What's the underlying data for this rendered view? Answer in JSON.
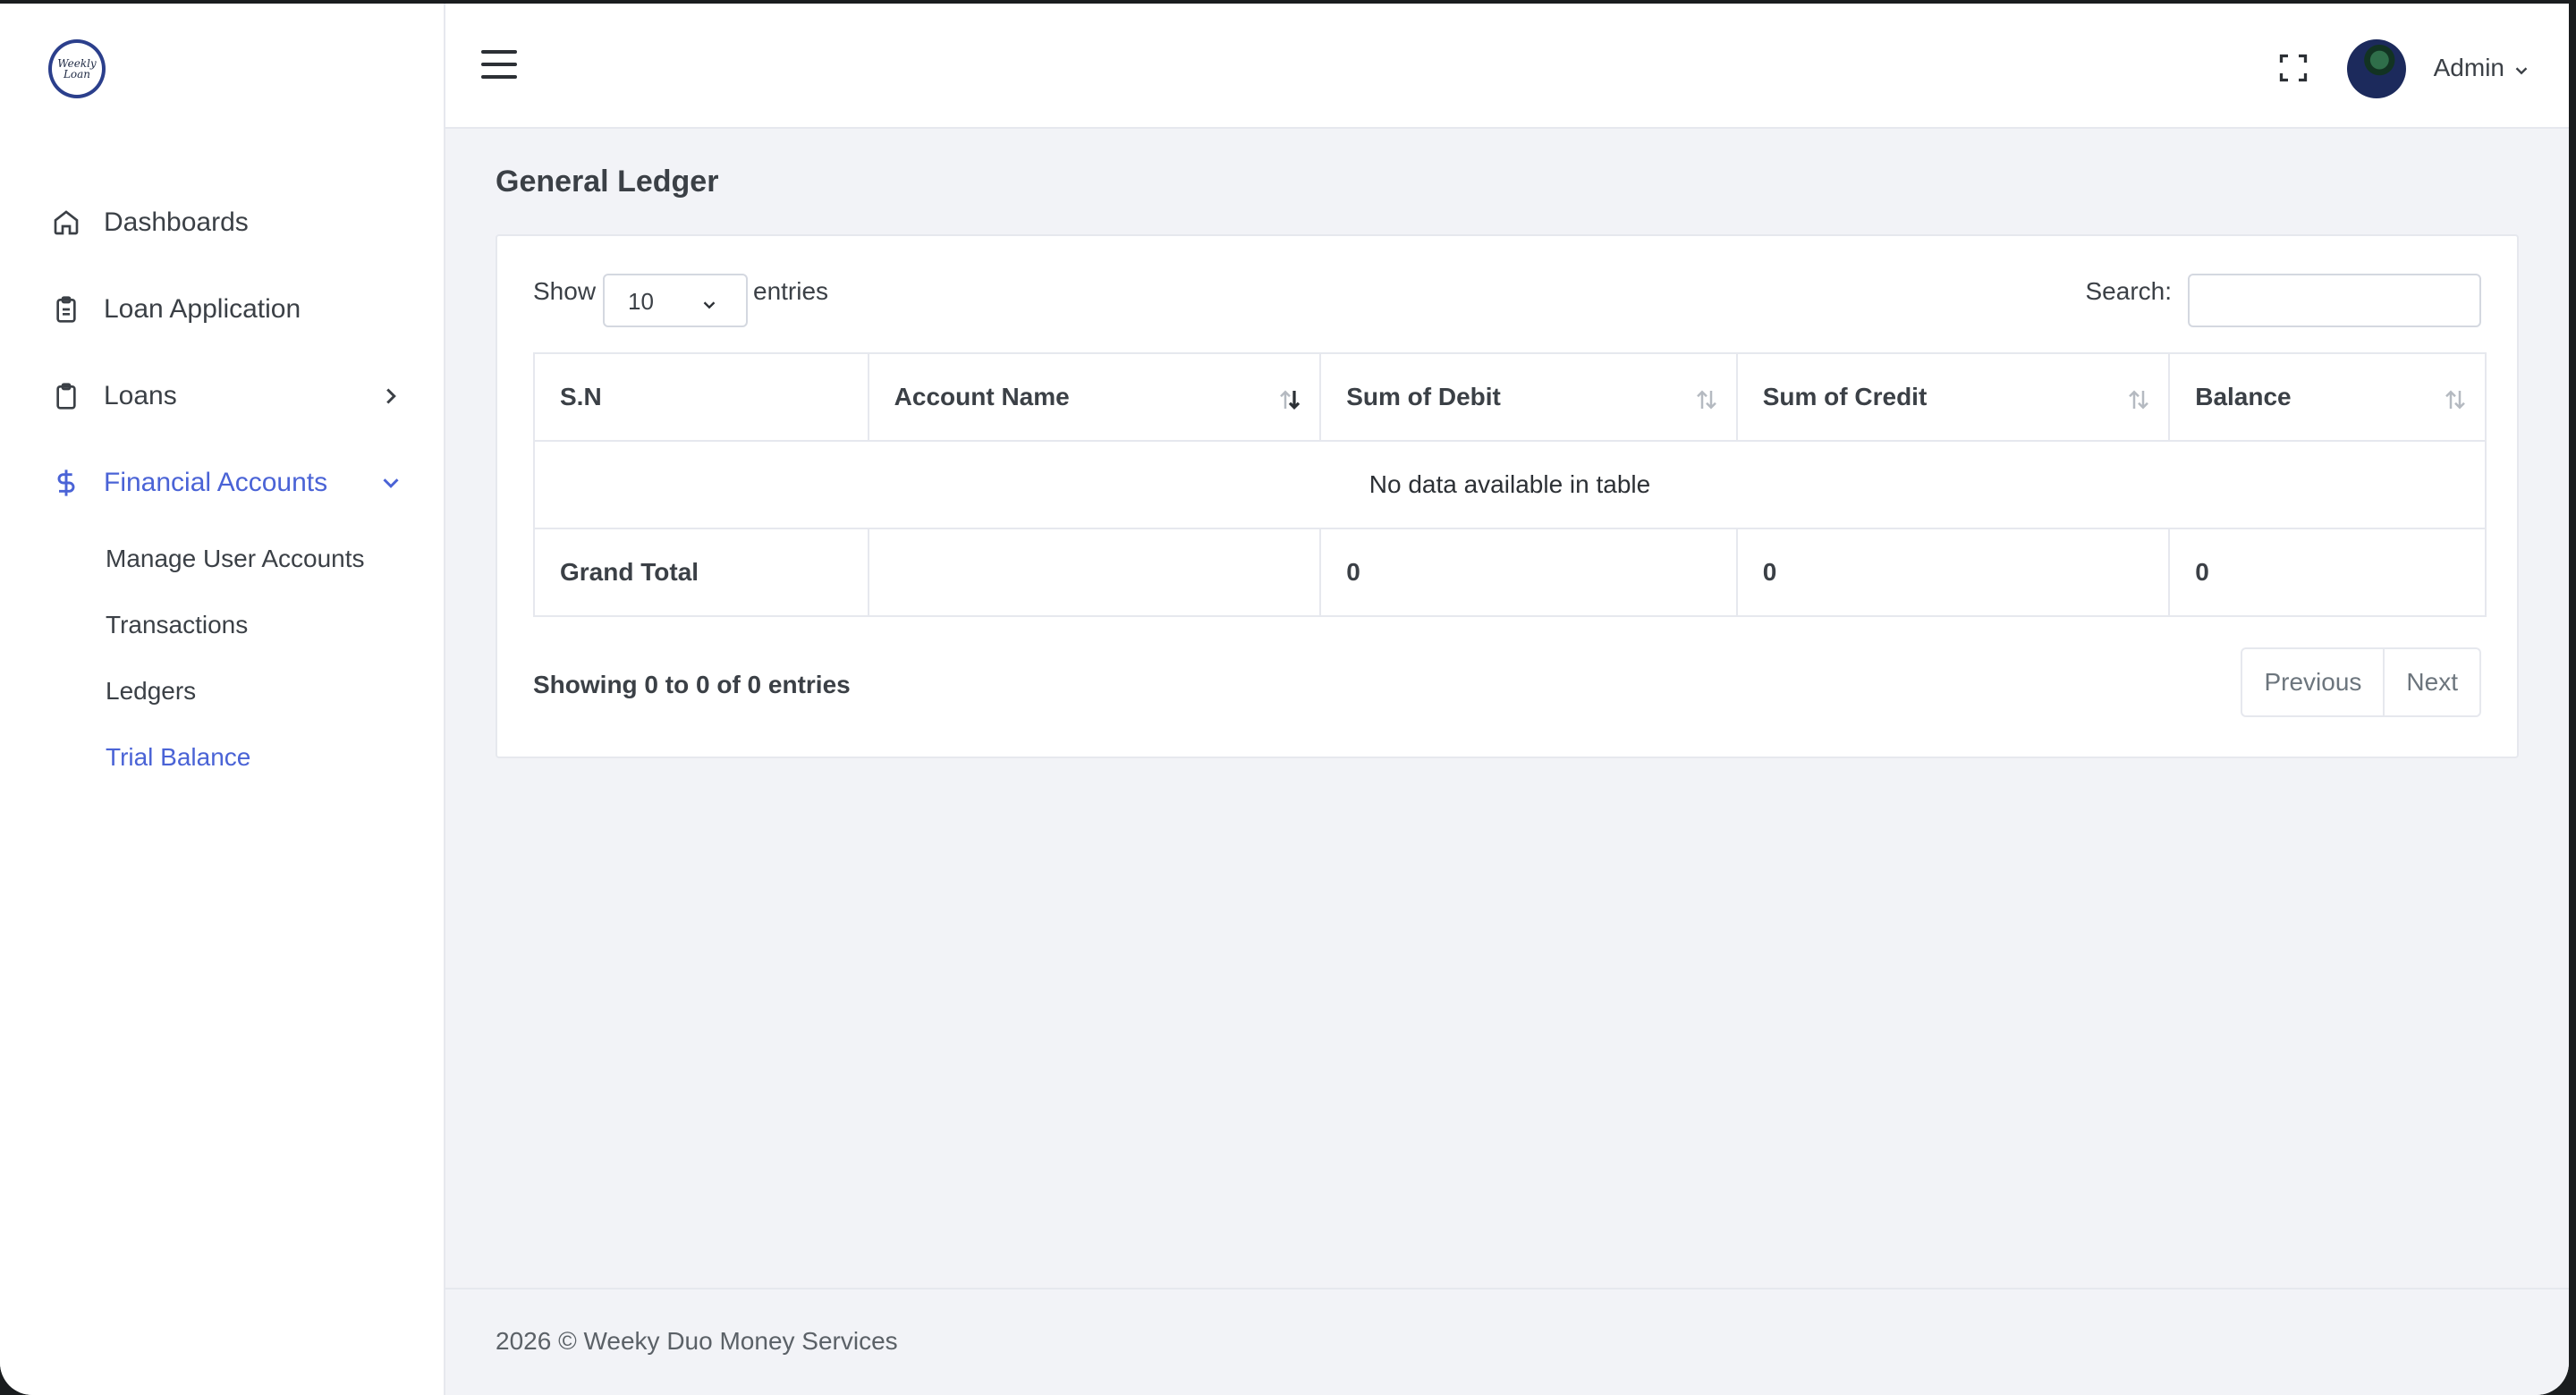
{
  "sidebar": {
    "logo_text": [
      "Weekly",
      "Loan"
    ],
    "items": [
      {
        "label": "Dashboards",
        "icon": "home-icon"
      },
      {
        "label": "Loan Application",
        "icon": "clipboard-icon"
      },
      {
        "label": "Loans",
        "icon": "clipboard-icon"
      },
      {
        "label": "Financial Accounts",
        "icon": "dollar-icon"
      }
    ],
    "sub_items": [
      "Manage User Accounts",
      "Transactions",
      "Ledgers",
      "Trial Balance"
    ],
    "accent_color": "#4a63d6"
  },
  "topbar": {
    "user": "Admin"
  },
  "page": {
    "title": "General Ledger"
  },
  "controls": {
    "show_label": "Show",
    "entries_value": "10",
    "entries_label": "entries",
    "search_label": "Search:",
    "search_value": ""
  },
  "table": {
    "headers": [
      "S.N",
      "Account Name",
      "Sum of Debit",
      "Sum of Credit",
      "Balance"
    ],
    "empty_message": "No data available in table",
    "total_row": [
      "Grand Total",
      "",
      "0",
      "0",
      "0"
    ]
  },
  "pagination": {
    "info": "Showing 0 to 0 of 0 entries",
    "previous": "Previous",
    "next": "Next"
  },
  "footer": {
    "text": "2026 © Weeky Duo Money Services"
  }
}
